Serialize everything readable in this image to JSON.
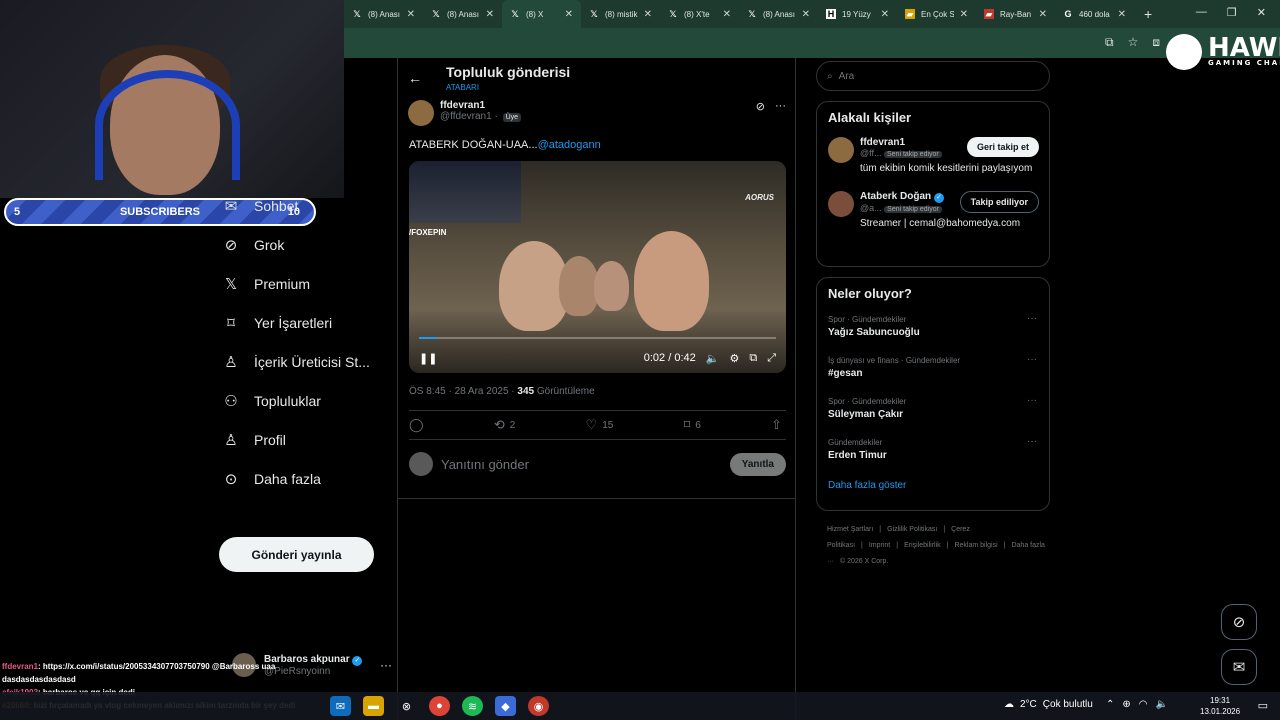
{
  "browser": {
    "tabs": [
      {
        "icon": "x-icon",
        "label": "(8) Anası",
        "active": false
      },
      {
        "icon": "x-icon",
        "label": "(8) Anası",
        "active": false
      },
      {
        "icon": "x-icon",
        "label": "(8) X",
        "active": true
      },
      {
        "icon": "x-icon",
        "label": "(8) mistik",
        "active": false
      },
      {
        "icon": "x-icon",
        "label": "(8) X'te",
        "active": false
      },
      {
        "icon": "x-icon",
        "label": "(8) Anası",
        "active": false
      },
      {
        "icon": "h-icon",
        "label": "19 Yüzy",
        "active": false
      },
      {
        "icon": "folder-icon",
        "label": "En Çok S",
        "active": false
      },
      {
        "icon": "flag-icon",
        "label": "Ray-Ban",
        "active": false
      },
      {
        "icon": "google-icon",
        "label": "460 dola",
        "active": false
      }
    ],
    "newtab": "+"
  },
  "overlay": {
    "logo_word": "HAWK",
    "logo_sub": "GAMING CHAIR",
    "sub_left": "5",
    "sub_label": "SUBSCRIBERS",
    "sub_right": "10"
  },
  "nav": {
    "items": [
      {
        "icon": "chat-icon",
        "glyph": "✉",
        "label": "Sohbet"
      },
      {
        "icon": "grok-icon",
        "glyph": "⊘",
        "label": "Grok"
      },
      {
        "icon": "x-icon",
        "glyph": "𝕏",
        "label": "Premium"
      },
      {
        "icon": "bookmark-icon",
        "glyph": "⌑",
        "label": "Yer İşaretleri"
      },
      {
        "icon": "creator-icon",
        "glyph": "♙",
        "label": "İçerik Üreticisi St..."
      },
      {
        "icon": "communities-icon",
        "glyph": "⚇",
        "label": "Topluluklar"
      },
      {
        "icon": "profile-icon",
        "glyph": "♙",
        "label": "Profil"
      },
      {
        "icon": "more-icon",
        "glyph": "⊙",
        "label": "Daha fazla"
      }
    ],
    "post_button": "Gönderi yayınla",
    "account_name": "Barbaros akpunar",
    "account_handle": "@PieRsnyoinn"
  },
  "post": {
    "header_title": "Topluluk gönderisi",
    "header_sub": "ATABARI",
    "author_name": "ffdevran1",
    "author_handle": "@ffdevran1 ·",
    "author_badge": "Üye",
    "text": "ATABERK DOĞAN-UAA...",
    "mention": "@atadogann",
    "video": {
      "brand": "AORUS",
      "stream_tag": "/FOXEPIN",
      "time": "0:02 / 0:42",
      "progress": 0.05
    },
    "meta_time": "ÖS 8:45 · 28 Ara 2025 ·",
    "meta_views": "345",
    "meta_views_label": "Görüntüleme",
    "actions": {
      "reposts": "2",
      "likes": "15",
      "bookmarks": "6"
    },
    "reply_placeholder": "Yanıtını gönder",
    "reply_button": "Yanıtla"
  },
  "right": {
    "search_placeholder": "Ara",
    "related_title": "Alakalı kişiler",
    "related": [
      {
        "name": "ffdevran1",
        "handle": "@ff...",
        "tag": "Seni takip ediyor",
        "bio": "tüm ekibin komik kesitlerini paylaşıyom",
        "button": "Geri takip et",
        "style": "white",
        "verified": false
      },
      {
        "name": "Ataberk Doğan",
        "handle": "@a...",
        "tag": "Seni takip ediyor",
        "bio": "Streamer | cemal@bahomedya.com",
        "button": "Takip ediliyor",
        "style": "outline",
        "verified": true
      }
    ],
    "trends_title": "Neler oluyor?",
    "trends": [
      {
        "context": "Spor · Gündemdekiler",
        "title": "Yağız Sabuncuoğlu"
      },
      {
        "context": "İş dünyası ve finans · Gündemdekiler",
        "title": "#gesan"
      },
      {
        "context": "Spor · Gündemdekiler",
        "title": "Süleyman Çakır"
      },
      {
        "context": "Gündemdekiler",
        "title": "Erden Timur"
      }
    ],
    "show_more": "Daha fazla göster",
    "footer": [
      "Hizmet Şartları",
      "|",
      "Gizlilik Politikası",
      "|",
      "Çerez Politikası",
      "|",
      "Imprint",
      "|",
      "Erişilebilirlik",
      "|",
      "Reklam bilgisi",
      "|",
      "Daha fazla ···",
      "© 2026 X Corp."
    ]
  },
  "chat": [
    {
      "user": "ffdevran1",
      "msg": ": https://x.com/i/status/2005334307703750790 @Barbaross uaa dasdasdasdasdasd"
    },
    {
      "user": "efejk1903",
      "msg": ": barbaros ve qq için dedi"
    },
    {
      "user": "e20li60",
      "msg": ": bizi fırçalamadı ya vlog cekmeyen aklımızı sikim tarzında bir şey dedi"
    }
  ],
  "taskbar": {
    "weather": "2°C",
    "weather_text": "Çok bulutlu",
    "time": "19:31",
    "date": "13.01.2026"
  },
  "colors": {
    "accent": "#1d9bf0",
    "border": "#2f3336",
    "browser": "#23493a",
    "sub_bar": "#3f5fc9"
  }
}
